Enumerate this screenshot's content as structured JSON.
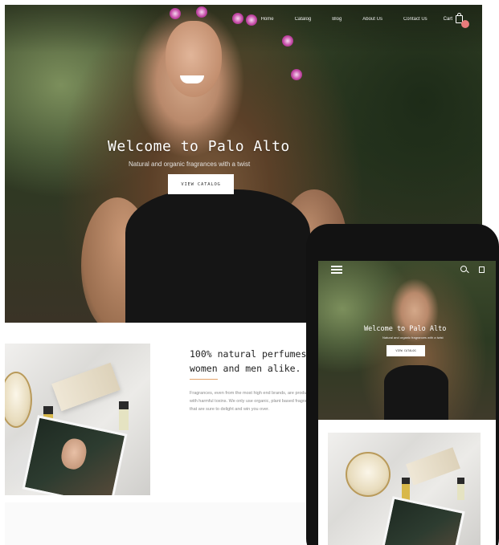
{
  "desktop": {
    "nav": {
      "items": [
        "Home",
        "Catalog",
        "Blog",
        "About Us",
        "Contact Us"
      ],
      "cart_label": "Cart"
    },
    "hero": {
      "title": "Welcome to Palo Alto",
      "subtitle": "Natural and organic fragrances with a twist",
      "button_label": "VIEW CATALOG"
    },
    "feature": {
      "headline_line1": "100% natural perfumes",
      "headline_line2": "women and men alike.",
      "body": "Fragrances, even from the most high end brands, are produced with harmful toxins. We only use organic, plant based fragrances that are sure to delight and win you over."
    }
  },
  "mobile": {
    "hero": {
      "title": "Welcome to Palo Alto",
      "subtitle": "Natural and organic fragrances with a twist",
      "button_label": "VIEW CATALOG"
    }
  },
  "colors": {
    "accent": "#e2a36b",
    "cart_badge": "#e87b7b",
    "phone_frame": "#121212"
  }
}
